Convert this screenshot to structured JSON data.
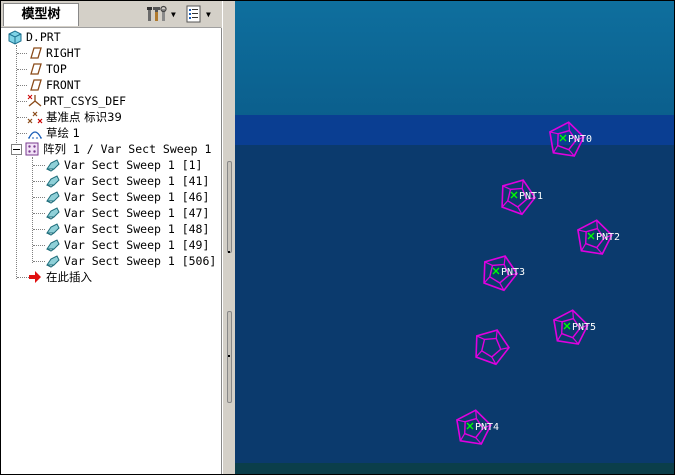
{
  "panel": {
    "tab_label": "模型树",
    "toolbar": [
      {
        "name": "settings-icon",
        "has_menu": true
      },
      {
        "name": "show-icon",
        "has_menu": true
      }
    ]
  },
  "tree": {
    "root": "D.PRT",
    "items": [
      {
        "label": "RIGHT",
        "icon": "datum-plane-icon"
      },
      {
        "label": "TOP",
        "icon": "datum-plane-icon"
      },
      {
        "label": "FRONT",
        "icon": "datum-plane-icon"
      },
      {
        "label": "PRT_CSYS_DEF",
        "icon": "coordinate-system-icon"
      },
      {
        "label": "基准点 标识39",
        "icon": "datum-point-icon"
      },
      {
        "label": "草绘 1",
        "icon": "sketch-icon"
      },
      {
        "label": "阵列 1 / Var Sect Sweep 1",
        "icon": "pattern-icon",
        "expanded": true
      }
    ],
    "pattern_children": [
      "Var Sect Sweep 1 [1]",
      "Var Sect Sweep 1 [41]",
      "Var Sect Sweep 1 [46]",
      "Var Sect Sweep 1 [47]",
      "Var Sect Sweep 1 [48]",
      "Var Sect Sweep 1 [49]",
      "Var Sect Sweep 1 [506]"
    ],
    "insert_here": "在此插入"
  },
  "viewport": {
    "colors": {
      "background_top": "#0e6f9e",
      "background_band": "#0a3e92",
      "background_low": "#0b3a6d",
      "geometry": "#e000e0",
      "point_marker": "#00ff00"
    },
    "points": [
      {
        "label": "PNT0"
      },
      {
        "label": "PNT1"
      },
      {
        "label": "PNT2"
      },
      {
        "label": "PNT3"
      },
      {
        "label": "PNT5"
      },
      {
        "label": ""
      },
      {
        "label": "PNT4"
      }
    ]
  }
}
